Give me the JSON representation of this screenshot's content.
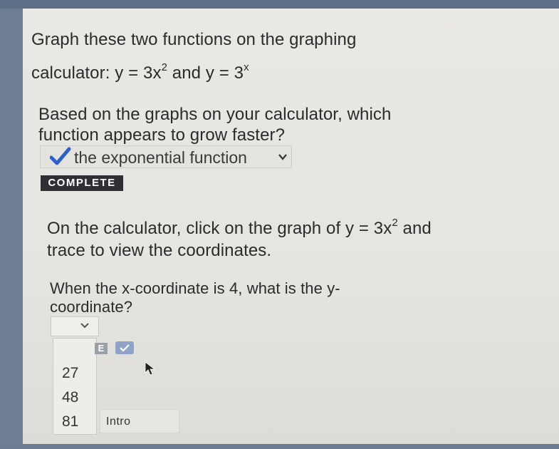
{
  "question1": {
    "line1": "Graph these two functions on the graphing",
    "line2_prefix": "calculator: y = 3x",
    "line2_exp1": "2",
    "line2_middle": " and y = 3",
    "line2_exp2": "x",
    "line3": "Based on the graphs on your calculator, which",
    "line4": "function appears to grow faster?",
    "answer_selected": "the exponential function",
    "status_badge": "COMPLETE"
  },
  "question2": {
    "line1_prefix": "On the calculator, click on the graph of y = 3x",
    "line1_exp": "2",
    "line1_suffix": " and",
    "line2": "trace to view the coordinates.",
    "line3": "When the x-coordinate is 4, what is the  y-",
    "line4": "coordinate?",
    "options": [
      "27",
      "48",
      "81"
    ],
    "e_button": "E"
  },
  "intro_button": "Intro",
  "colors": {
    "panel_bg": "#e7e6e2",
    "outer_bg": "#6e7e92",
    "check_blue": "#2f5fc8",
    "badge_bg": "#2f3033"
  },
  "icons": [
    "checkmark-icon",
    "chevron-down-icon",
    "pointer-cursor-icon"
  ]
}
